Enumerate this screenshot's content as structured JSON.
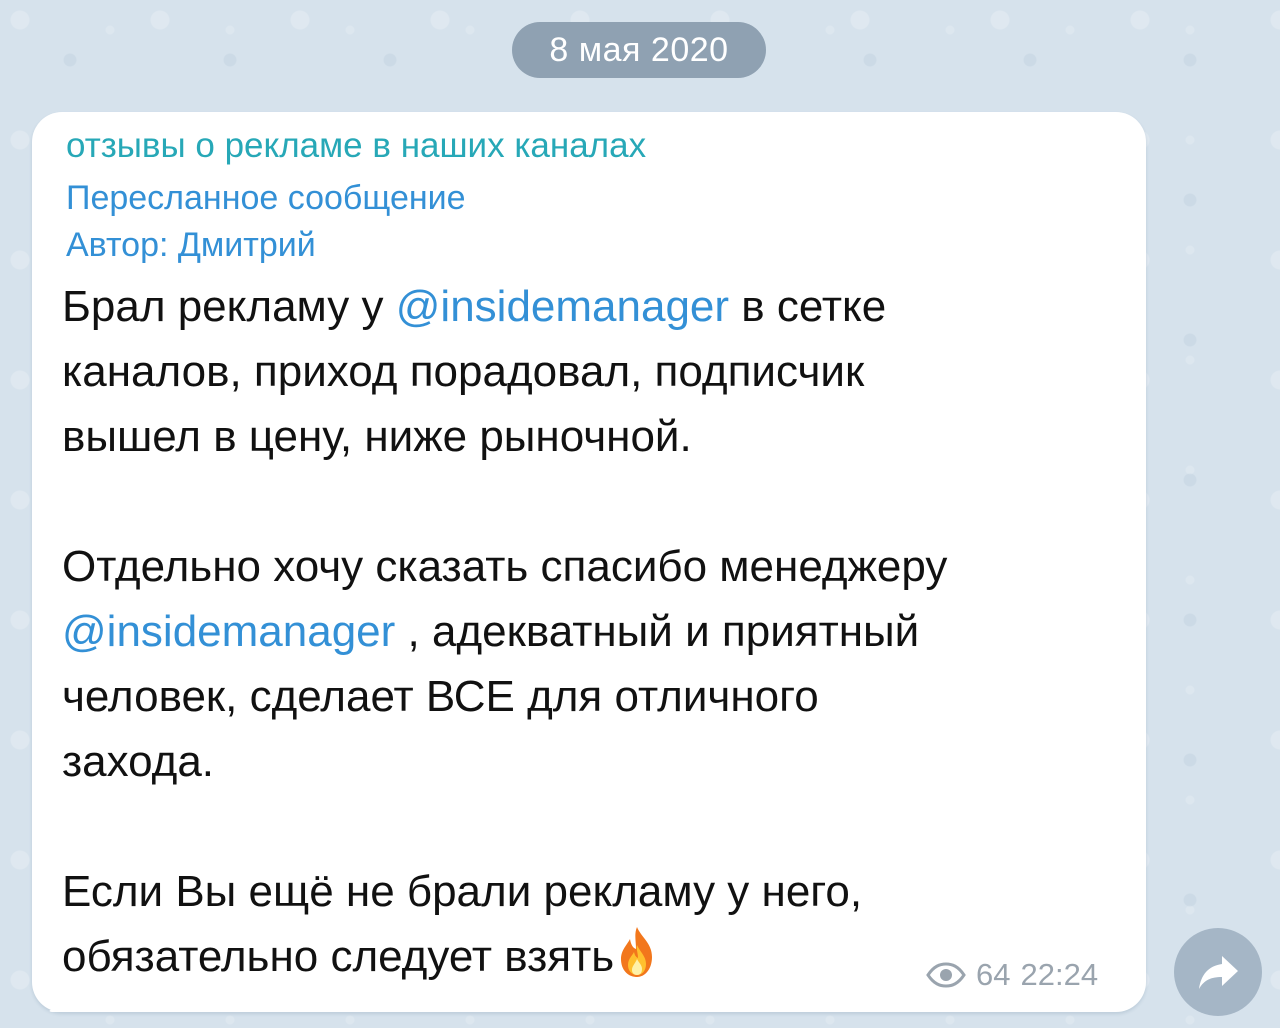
{
  "date_separator": "8 мая 2020",
  "message": {
    "channel_name": "отзывы о рекламе в наших каналах",
    "forwarded_label": "Пересланное сообщение",
    "author_line": "Автор: Дмитрий",
    "p1_a": "Брал рекламу у ",
    "p1_mention": "@insidemanager",
    "p1_b": " в сетке\nканалов, приход порадовал, подписчик\nвышел в цену, ниже рыночной.\n\nОтдельно хочу сказать спасибо менеджеру\n",
    "p2_mention": "@insidemanager",
    "p2_b": " , адекватный и приятный\nчеловек, сделает ВСЕ для отличного\nзахода.\n\nЕсли Вы ещё не брали рекламу у него,\nобязательно следует взять",
    "views": "64",
    "time": "22:24"
  },
  "icons": {
    "views": "eye-icon",
    "share": "share-arrow-icon",
    "emoji": "fire-emoji"
  },
  "colors": {
    "background": "#d6e2ec",
    "date_pill": "#8fa1b2",
    "channel_name": "#27a8b7",
    "link": "#3390d6",
    "meta_text": "#9aa4ae",
    "share_button": "#a5b6c6"
  }
}
